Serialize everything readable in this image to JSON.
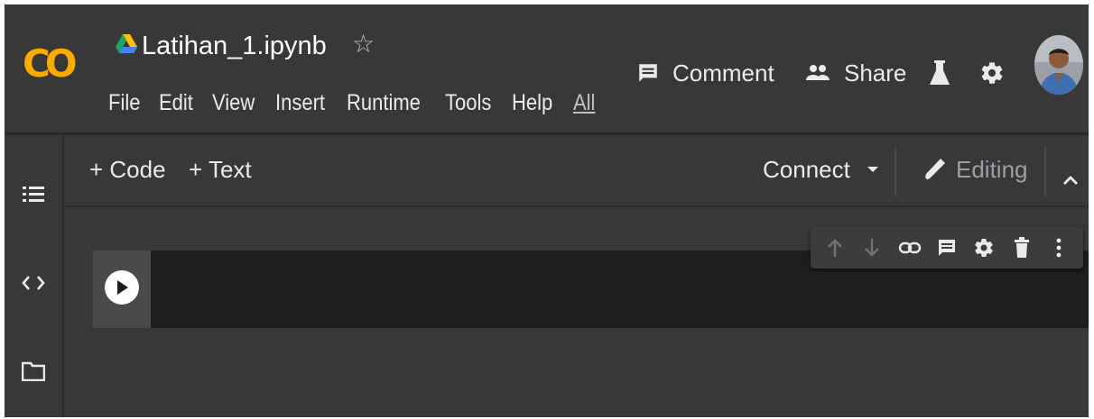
{
  "app": {
    "logo_text": "CO",
    "notebook_name": "Latihan_1.ipynb",
    "logo_color": "#f9ab00"
  },
  "menu": {
    "items": [
      "File",
      "Edit",
      "View",
      "Insert",
      "Runtime",
      "Tools",
      "Help"
    ],
    "all_label": "All"
  },
  "header_actions": {
    "comment_label": "Comment",
    "share_label": "Share"
  },
  "toolbar": {
    "add_code_label": "+ Code",
    "add_text_label": "+ Text",
    "connect_label": "Connect",
    "editing_label": "Editing"
  },
  "icons": {
    "drive": "google-drive-icon",
    "star": "star-outline-icon",
    "comment": "comment-icon",
    "share": "people-icon",
    "lab": "flask-icon",
    "settings": "gear-icon",
    "toc": "table-of-contents-icon",
    "snippets": "code-brackets-icon",
    "files": "folder-icon",
    "run": "play-icon",
    "cell_actions": [
      "arrow-up-icon",
      "arrow-down-icon",
      "link-icon",
      "comment-icon",
      "gear-icon",
      "trash-icon",
      "more-vert-icon"
    ]
  },
  "colors": {
    "background": "#383838",
    "cell_background": "#1e1e1e",
    "text": "#e8eaed"
  }
}
